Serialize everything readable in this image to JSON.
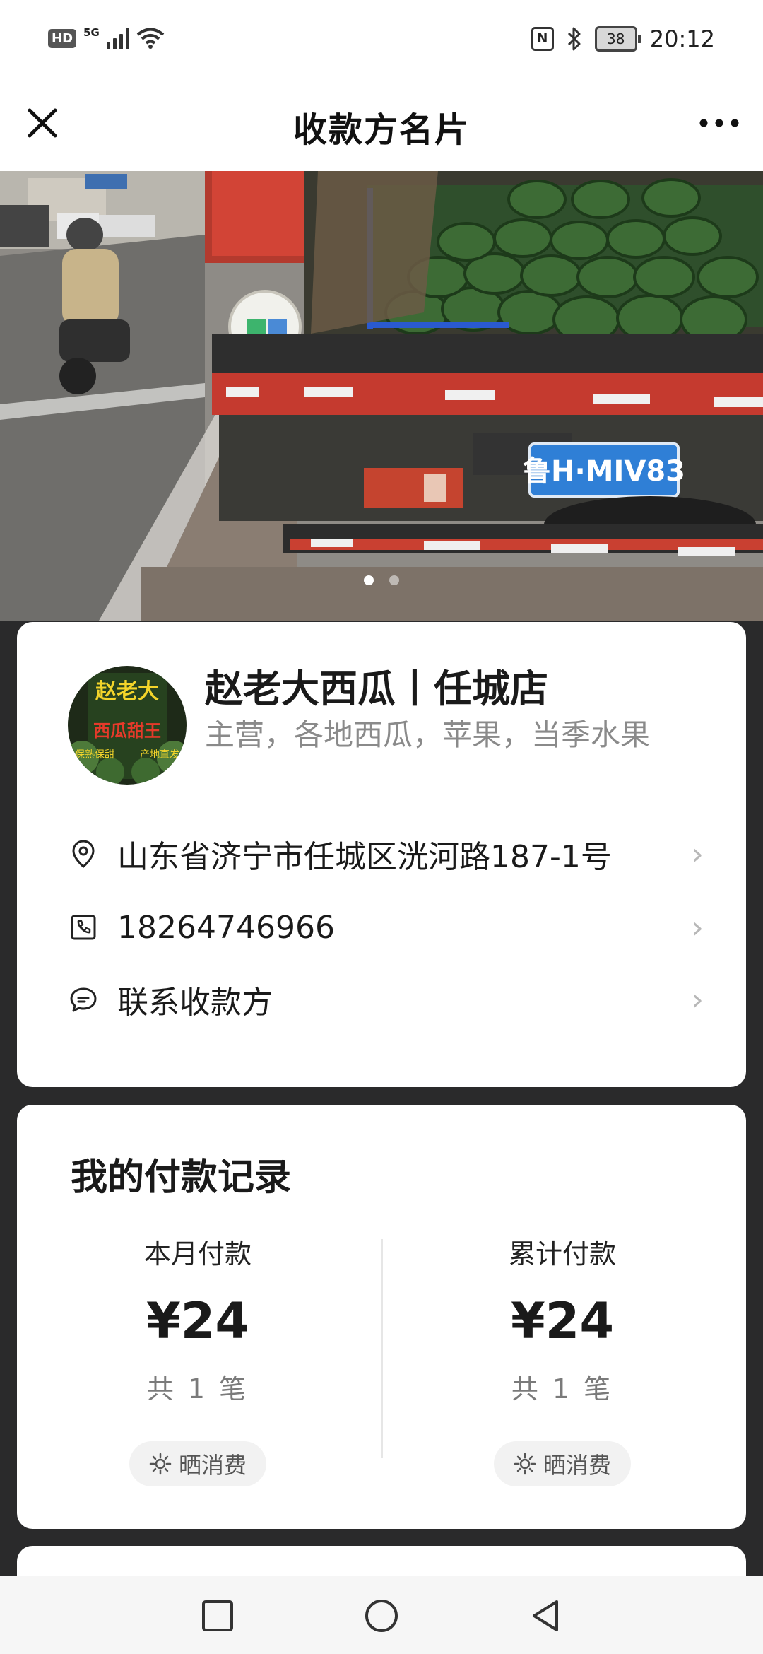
{
  "status_bar": {
    "hd": "HD",
    "network": "5G",
    "time": "20:12",
    "battery": "38",
    "nfc": "N",
    "icons": [
      "signal-icon",
      "wifi-icon",
      "nfc-icon",
      "bluetooth-icon",
      "battery-icon"
    ]
  },
  "header": {
    "title": "收款方名片",
    "close_icon": "close-icon",
    "more_icon": "more-icon"
  },
  "banner": {
    "plate": "鲁H·MIV83",
    "page_count": 2,
    "active_page": 1
  },
  "merchant": {
    "name": "赵老大西瓜丨任城店",
    "description": "主营，各地西瓜，苹果，当季水果",
    "avatar_text": {
      "top": "赵老大",
      "middle": "西瓜甜王",
      "left": "保熟保甜",
      "right": "产地直发"
    },
    "rows": [
      {
        "icon": "location-pin-icon",
        "text": "山东省济宁市任城区洸河路187-1号"
      },
      {
        "icon": "phone-icon",
        "text": "18264746966"
      },
      {
        "icon": "chat-bubble-icon",
        "text": "联系收款方"
      }
    ],
    "chevron": "›"
  },
  "payment_record": {
    "title": "我的付款记录",
    "month": {
      "label": "本月付款",
      "amount": "¥24",
      "count": "共 1 笔",
      "share": "晒消费"
    },
    "total": {
      "label": "累计付款",
      "amount": "¥24",
      "count": "共 1 笔",
      "share": "晒消费"
    }
  },
  "colors": {
    "page_background": "#2a2a2b",
    "card": "#ffffff",
    "secondary_text": "#8a8a8a",
    "plate_blue": "#2f7fd6"
  },
  "nav": {
    "icons": [
      "recent-apps-icon",
      "home-icon",
      "back-icon"
    ]
  }
}
